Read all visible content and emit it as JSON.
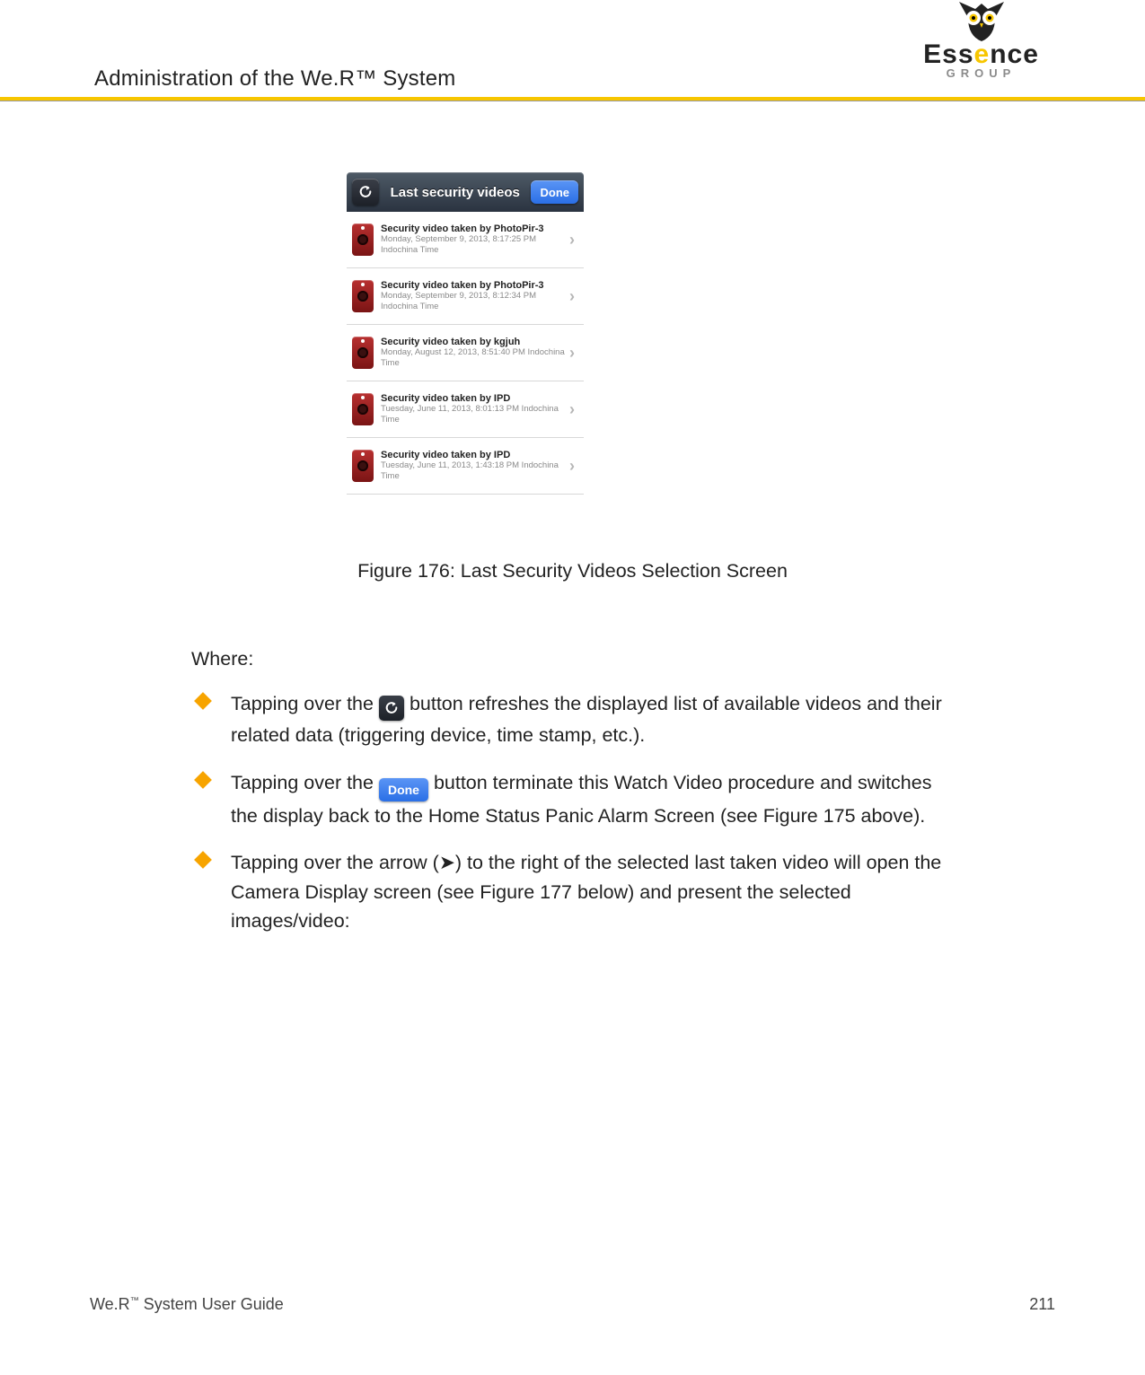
{
  "header": {
    "title": "Administration of the We.R™ System",
    "logo_word": "Essence",
    "logo_group": "GROUP"
  },
  "screenshot": {
    "nav_title": "Last security videos",
    "done_label": "Done",
    "rows": [
      {
        "title": "Security video taken by PhotoPir-3",
        "sub": "Monday, September 9, 2013, 8:17:25 PM Indochina Time"
      },
      {
        "title": "Security video taken by PhotoPir-3",
        "sub": "Monday, September 9, 2013, 8:12:34 PM Indochina Time"
      },
      {
        "title": "Security video taken by kgjuh",
        "sub": "Monday, August 12, 2013, 8:51:40 PM Indochina Time"
      },
      {
        "title": "Security video taken by IPD",
        "sub": "Tuesday, June 11, 2013, 8:01:13 PM Indochina Time"
      },
      {
        "title": "Security video taken by IPD",
        "sub": "Tuesday, June 11, 2013, 1:43:18 PM Indochina Time"
      }
    ]
  },
  "figure_caption": "Figure 176: Last Security Videos Selection Screen",
  "body": {
    "where_label": "Where:",
    "bullet1_a": "Tapping over the ",
    "bullet1_b": " button refreshes the displayed list of available videos and their related data (triggering device, time stamp, etc.).",
    "bullet2_a": "Tapping over the ",
    "bullet2_done": "Done",
    "bullet2_b": " button terminate this Watch Video procedure and switches the display back to the Home Status Panic Alarm Screen (see Figure 175 above).",
    "bullet3": "Tapping over the arrow (➤) to the right of the selected last taken video will open the Camera Display screen (see Figure 177 below) and present the selected images/video:"
  },
  "footer": {
    "left_a": "We.R",
    "left_b": " System User Guide",
    "page_num": "211"
  }
}
